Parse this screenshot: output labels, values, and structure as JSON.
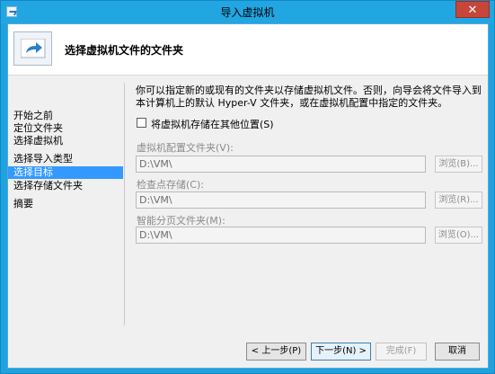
{
  "window": {
    "title": "导入虚拟机",
    "close_symbol": "✕"
  },
  "header": {
    "title": "选择虚拟机文件的文件夹"
  },
  "sidebar": {
    "items": [
      {
        "label": "开始之前"
      },
      {
        "label": "定位文件夹"
      },
      {
        "label": "选择虚拟机"
      },
      {
        "label": "选择导入类型"
      },
      {
        "label": "选择目标"
      },
      {
        "label": "选择存储文件夹"
      },
      {
        "label": "摘要"
      }
    ],
    "active_index": 4
  },
  "content": {
    "description": "你可以指定新的或现有的文件夹以存储虚拟机文件。否则，向导会将文件导入到本计算机上的默认 Hyper-V 文件夹，或在虚拟机配置中指定的文件夹。",
    "checkbox_label": "将虚拟机存储在其他位置(S)",
    "checkbox_checked": false,
    "fields": [
      {
        "label": "虚拟机配置文件夹(V):",
        "value": "D:\\VM\\",
        "browse": "浏览(B)..."
      },
      {
        "label": "检查点存储(C):",
        "value": "D:\\VM\\",
        "browse": "浏览(R)..."
      },
      {
        "label": "智能分页文件夹(M):",
        "value": "D:\\VM\\",
        "browse": "浏览(O)..."
      }
    ]
  },
  "footer": {
    "prev": "< 上一步(P)",
    "next": "下一步(N) >",
    "finish": "完成(F)",
    "cancel": "取消"
  },
  "colors": {
    "titlebar": "#21a6e2",
    "selection": "#3399ff",
    "close": "#c7463a"
  }
}
